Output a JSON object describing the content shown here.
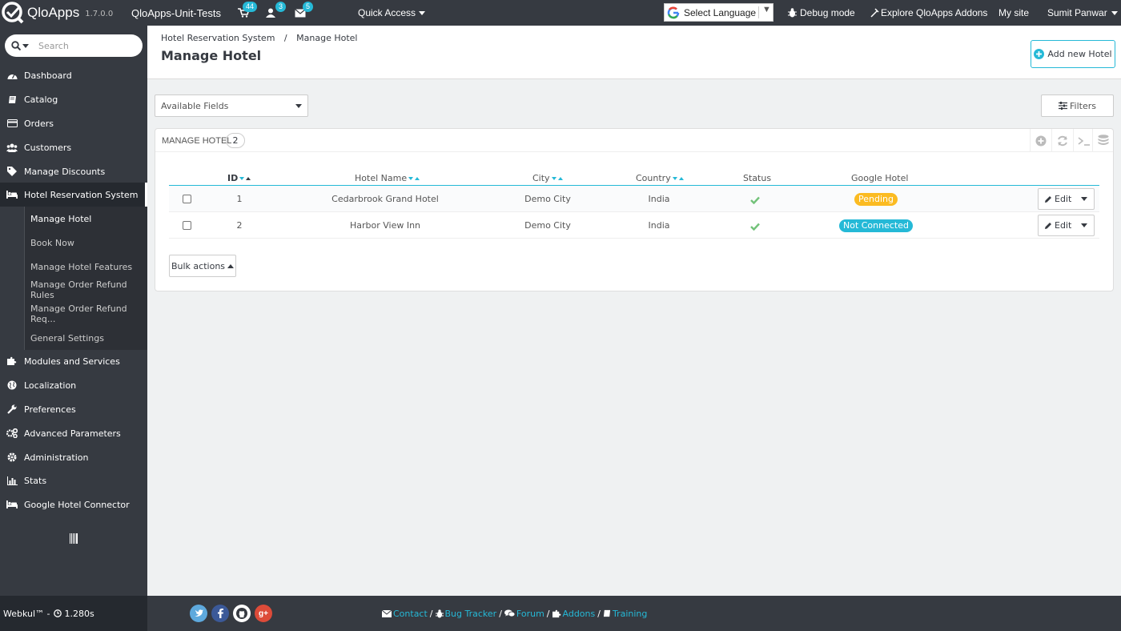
{
  "topbar": {
    "brand": "QloApps",
    "version": "1.7.0.0",
    "shop_name": "QloApps-Unit-Tests",
    "orders_count": "44",
    "customers_count": "3",
    "messages_count": "5",
    "quick_access": "Quick Access",
    "language": "Select Language",
    "debug": "Debug mode",
    "addons": "Explore QloApps Addons",
    "my_site": "My site",
    "user": "Sumit Panwar"
  },
  "sidebar": {
    "search_placeholder": "Search",
    "items": [
      {
        "label": "Dashboard",
        "icon": "dashboard-icon"
      },
      {
        "label": "Catalog",
        "icon": "book-icon"
      },
      {
        "label": "Orders",
        "icon": "credit-card-icon"
      },
      {
        "label": "Customers",
        "icon": "users-icon"
      },
      {
        "label": "Manage Discounts",
        "icon": "tag-icon"
      },
      {
        "label": "Hotel Reservation System",
        "icon": "bed-icon"
      },
      {
        "label": "Modules and Services",
        "icon": "puzzle-icon"
      },
      {
        "label": "Localization",
        "icon": "globe-icon"
      },
      {
        "label": "Preferences",
        "icon": "wrench-icon"
      },
      {
        "label": "Advanced Parameters",
        "icon": "gears-icon"
      },
      {
        "label": "Administration",
        "icon": "gear-icon"
      },
      {
        "label": "Stats",
        "icon": "bar-chart-icon"
      },
      {
        "label": "Google Hotel Connector",
        "icon": "bed-icon"
      }
    ],
    "subitems": [
      {
        "label": "Manage Hotel"
      },
      {
        "label": "Book Now"
      },
      {
        "label": "Manage Hotel Features"
      },
      {
        "label": "Manage Order Refund Rules"
      },
      {
        "label": "Manage Order Refund Req..."
      },
      {
        "label": "General Settings"
      }
    ]
  },
  "header": {
    "breadcrumb_parent": "Hotel Reservation System",
    "breadcrumb_sep": "/",
    "breadcrumb_current": "Manage Hotel",
    "title": "Manage Hotel",
    "add_button": "Add new Hotel"
  },
  "toolbar": {
    "available_fields": "Available Fields",
    "filters": "Filters"
  },
  "panel": {
    "title": "MANAGE HOTEL",
    "count": "2",
    "columns": [
      "ID",
      "Hotel Name",
      "City",
      "Country",
      "Status",
      "Google Hotel"
    ],
    "rows": [
      {
        "id": "1",
        "name": "Cedarbrook Grand Hotel",
        "city": "Demo City",
        "country": "India",
        "status": "enabled",
        "google": "Pending",
        "google_color": "#fbbb22",
        "edit": "Edit"
      },
      {
        "id": "2",
        "name": "Harbor View Inn",
        "city": "Demo City",
        "country": "India",
        "status": "enabled",
        "google": "Not Connected",
        "google_color": "#25b9d7",
        "edit": "Edit"
      }
    ],
    "bulk_actions": "Bulk actions"
  },
  "footer": {
    "brand": "Webkul™ -",
    "load_time": "1.280s",
    "links": [
      "Contact",
      "Bug Tracker",
      "Forum",
      "Addons",
      "Training"
    ],
    "separator": "/"
  },
  "colors": {
    "accent": "#25b9d7",
    "dark": "#363a41",
    "success": "#72c279",
    "pending": "#fbbb22"
  }
}
